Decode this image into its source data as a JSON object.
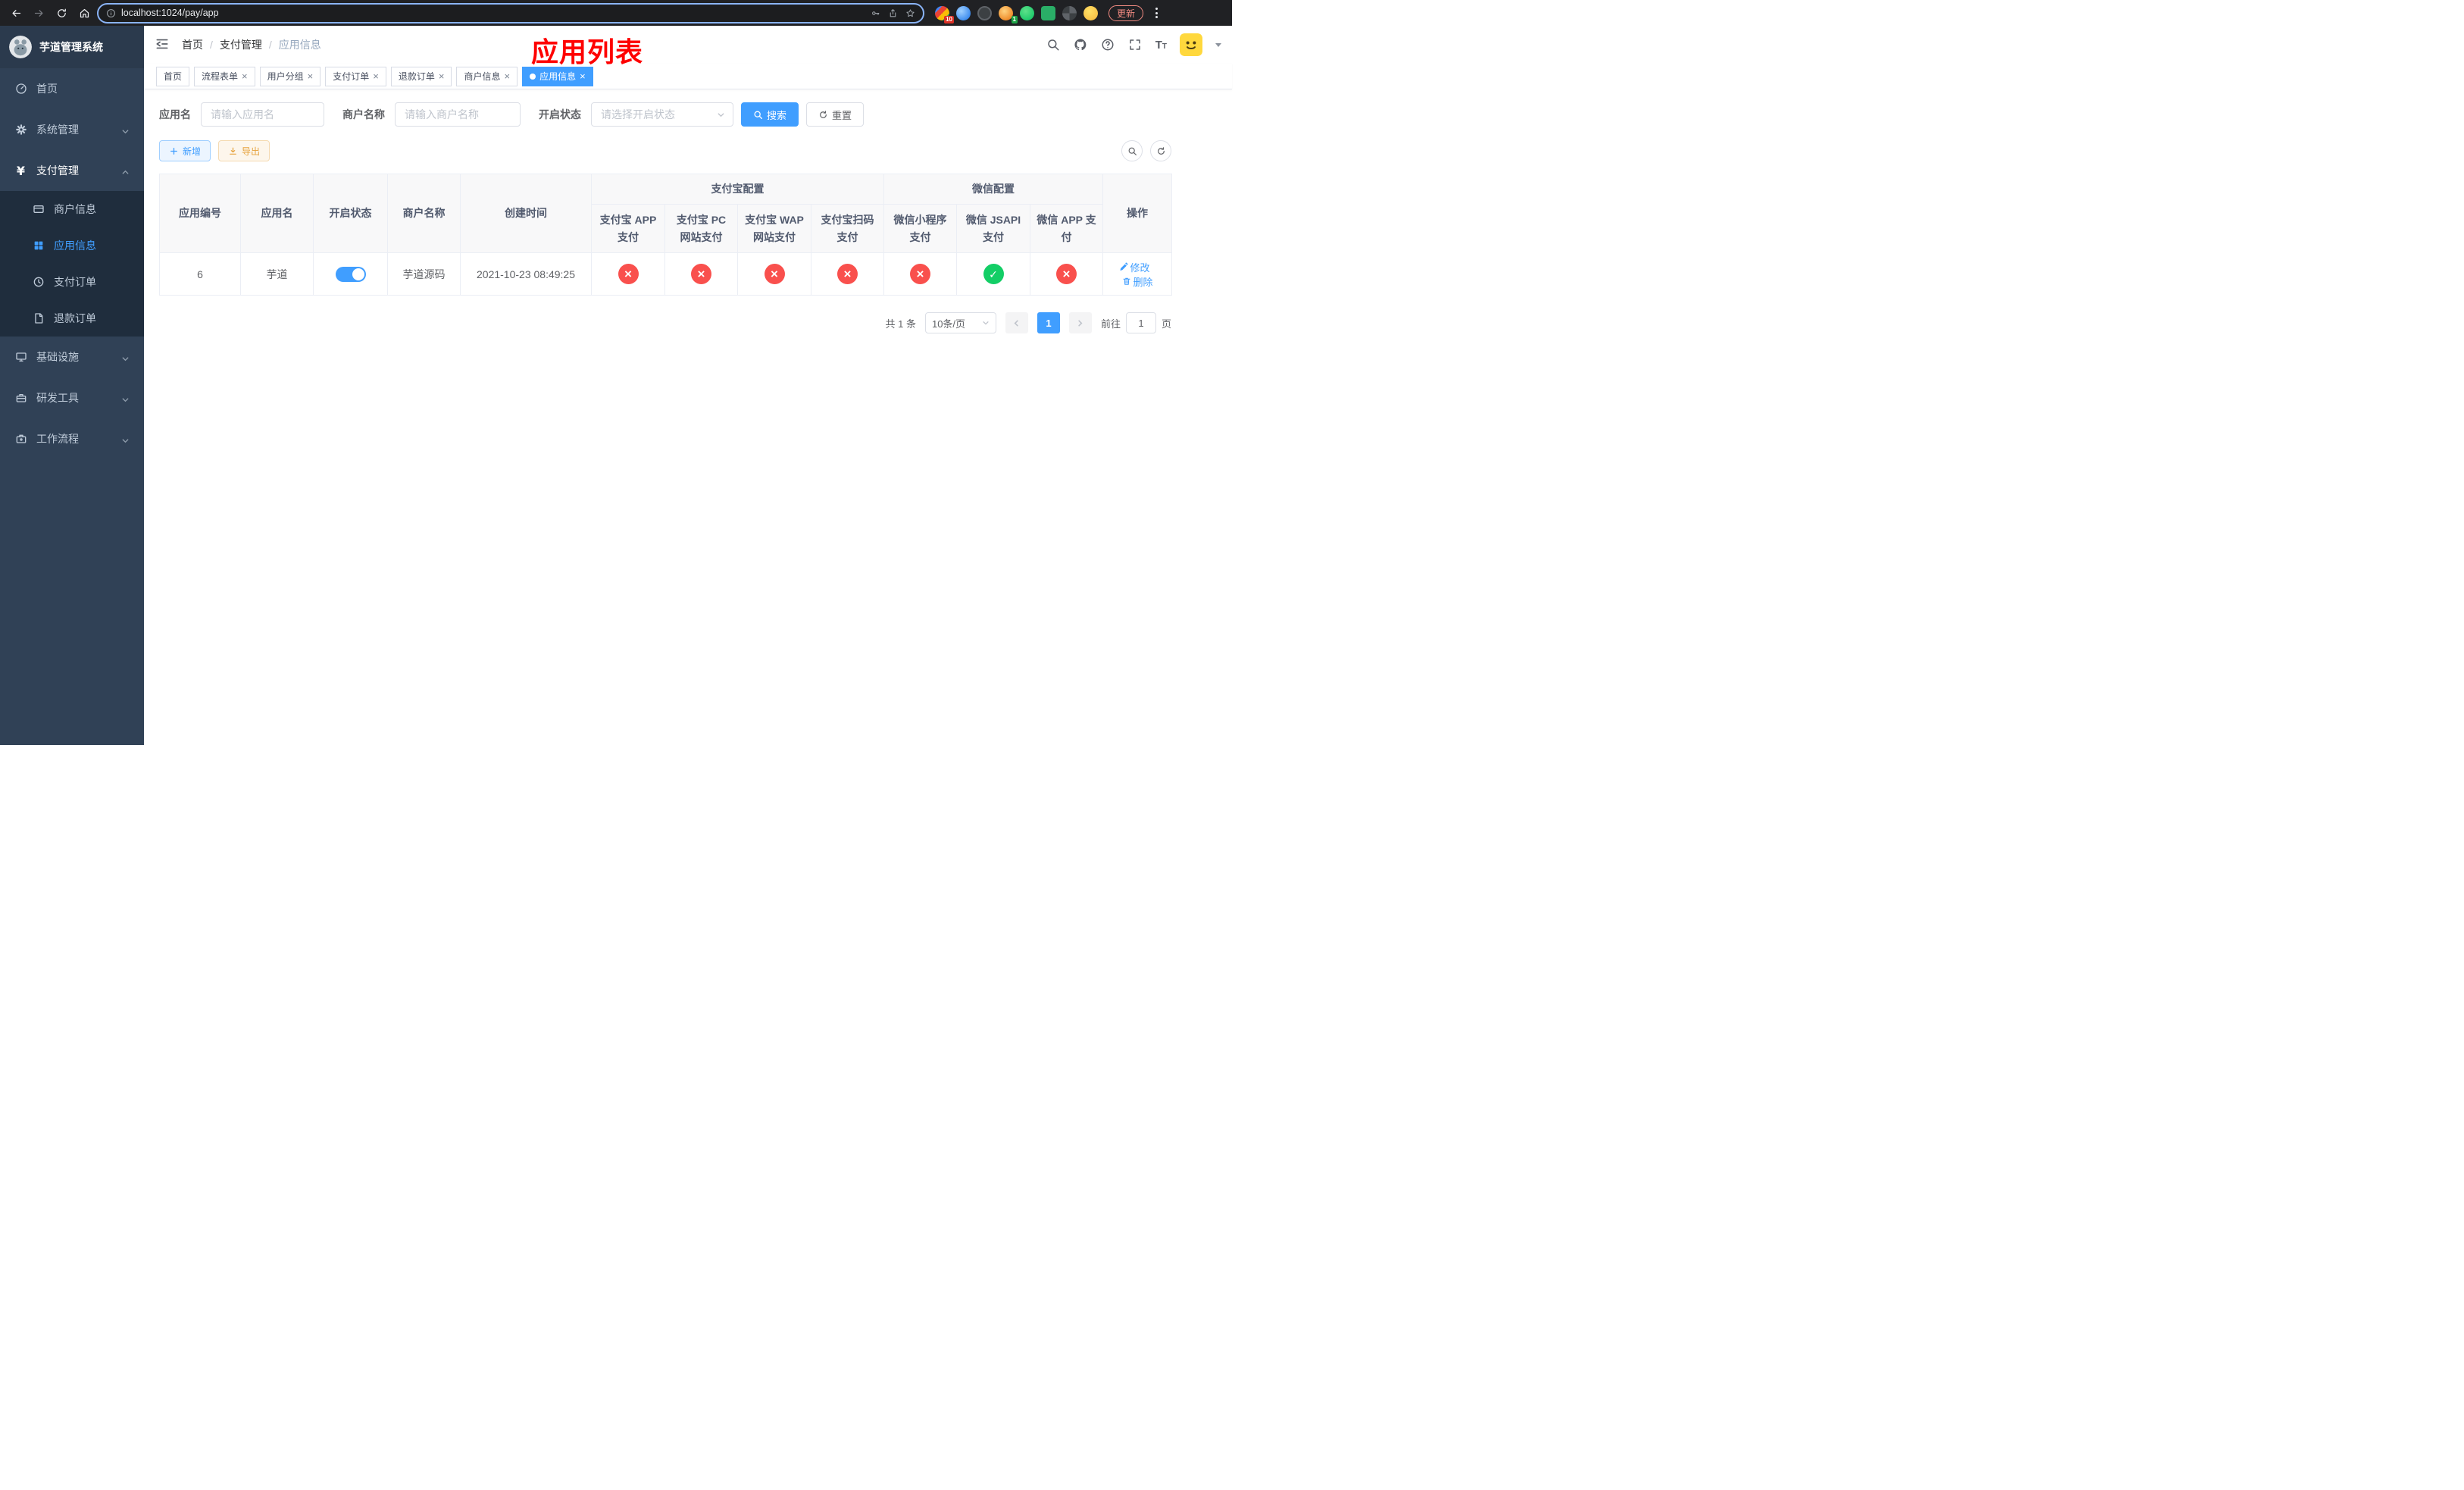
{
  "colors": {
    "primary": "#409eff",
    "success": "#13ce66",
    "danger": "#f9504d",
    "warning": "#e6a23c",
    "annotation": "#fe0000",
    "sidebar_bg": "#304156"
  },
  "browser": {
    "url": "localhost:1024/pay/app",
    "update_label": "更新",
    "ext_badge_1": "10",
    "ext_badge_2": "1"
  },
  "sidebar": {
    "logo_title": "芋道管理系统",
    "items": [
      {
        "label": "首页"
      },
      {
        "label": "系统管理"
      },
      {
        "label": "支付管理",
        "children": [
          {
            "label": "商户信息"
          },
          {
            "label": "应用信息"
          },
          {
            "label": "支付订单"
          },
          {
            "label": "退款订单"
          }
        ]
      },
      {
        "label": "基础设施"
      },
      {
        "label": "研发工具"
      },
      {
        "label": "工作流程"
      }
    ]
  },
  "header": {
    "breadcrumb": [
      "首页",
      "支付管理",
      "应用信息"
    ],
    "annotation": "应用列表"
  },
  "tabs": [
    {
      "label": "首页"
    },
    {
      "label": "流程表单"
    },
    {
      "label": "用户分组"
    },
    {
      "label": "支付订单"
    },
    {
      "label": "退款订单"
    },
    {
      "label": "商户信息"
    },
    {
      "label": "应用信息"
    }
  ],
  "filters": {
    "app_name_label": "应用名",
    "app_name_placeholder": "请输入应用名",
    "merchant_label": "商户名称",
    "merchant_placeholder": "请输入商户名称",
    "status_label": "开启状态",
    "status_placeholder": "请选择开启状态",
    "search_label": "搜索",
    "reset_label": "重置"
  },
  "toolbar": {
    "add_label": "新增",
    "export_label": "导出"
  },
  "table": {
    "group_headers": {
      "alipay": "支付宝配置",
      "wechat": "微信配置"
    },
    "columns": {
      "id": "应用编号",
      "name": "应用名",
      "status": "开启状态",
      "merchant": "商户名称",
      "created": "创建时间",
      "alipay_app": "支付宝 APP 支付",
      "alipay_pc": "支付宝 PC 网站支付",
      "alipay_wap": "支付宝 WAP 网站支付",
      "alipay_qr": "支付宝扫码支付",
      "wx_mini": "微信小程序支付",
      "wx_jsapi": "微信 JSAPI 支付",
      "wx_app": "微信 APP 支付",
      "actions": "操作"
    },
    "rows": [
      {
        "id": "6",
        "name": "芋道",
        "enabled": true,
        "merchant": "芋道源码",
        "created": "2021-10-23 08:49:25",
        "statuses": {
          "alipay_app": "fail",
          "alipay_pc": "fail",
          "alipay_wap": "fail",
          "alipay_qr": "fail",
          "wx_mini": "fail",
          "wx_jsapi": "success",
          "wx_app": "fail"
        },
        "edit_label": "修改",
        "delete_label": "删除"
      }
    ]
  },
  "pagination": {
    "total_text": "共 1 条",
    "page_size_text": "10条/页",
    "current_page": "1",
    "goto_label": "前往",
    "goto_value": "1",
    "unit_label": "页"
  }
}
